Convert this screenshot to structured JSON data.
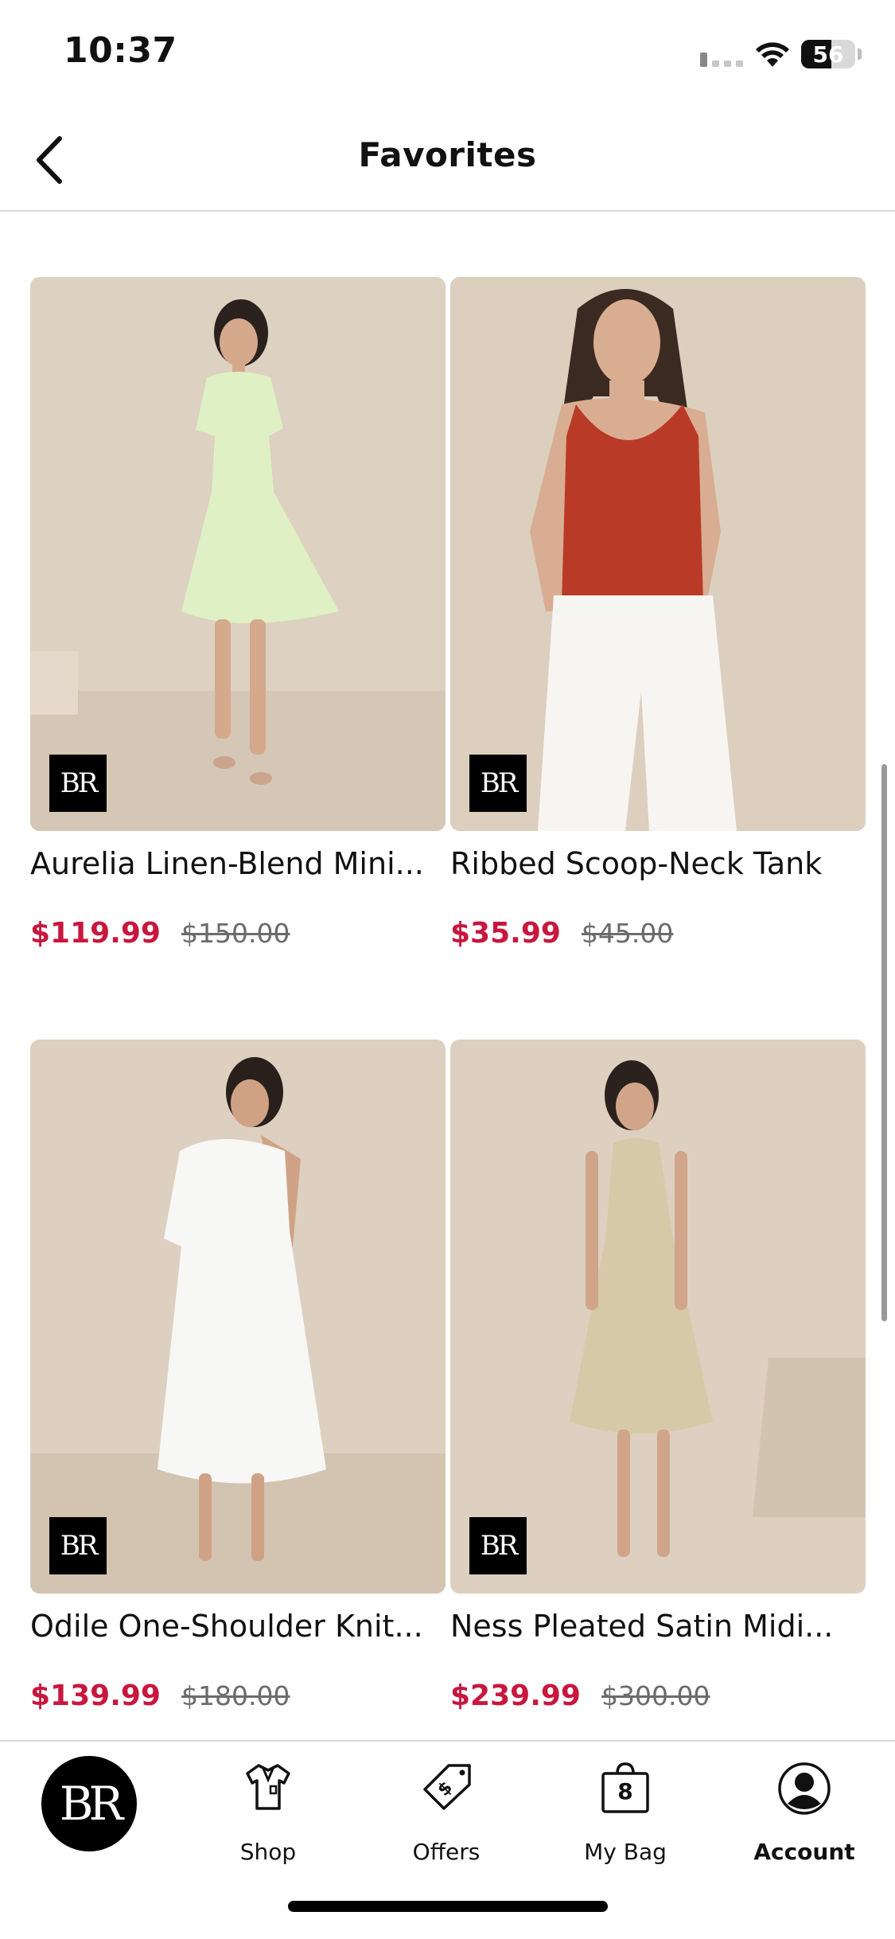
{
  "status_bar": {
    "time": "10:37",
    "battery_level": "56",
    "battery_fraction": 0.56
  },
  "header": {
    "title": "Favorites"
  },
  "products": [
    {
      "name": "Aurelia Linen-Blend Mini...",
      "sale_price": "$119.99",
      "original_price": "$150.00",
      "badge": "BR",
      "garment_color": "#dff0c4",
      "skin": "#d4a98c",
      "hair": "#2b211d"
    },
    {
      "name": "Ribbed Scoop-Neck Tank",
      "sale_price": "$35.99",
      "original_price": "$45.00",
      "badge": "BR",
      "garment_color": "#b93a26",
      "skin": "#d9ad92",
      "hair": "#3b2a22"
    },
    {
      "name": "Odile One-Shoulder Knit...",
      "sale_price": "$139.99",
      "original_price": "$180.00",
      "badge": "BR",
      "garment_color": "#f7f7f5",
      "skin": "#cfa286",
      "hair": "#2a201b"
    },
    {
      "name": "Ness Pleated Satin Midi...",
      "sale_price": "$239.99",
      "original_price": "$300.00",
      "badge": "BR",
      "garment_color": "#d6c9a8",
      "skin": "#d0a58a",
      "hair": "#2c221d"
    }
  ],
  "tab_bar": {
    "home_logo": "BR",
    "shop": "Shop",
    "offers": "Offers",
    "bag": "My Bag",
    "bag_count": "8",
    "account": "Account"
  },
  "colors": {
    "sale": "#c8173e",
    "photo_background": "#ddd1c1"
  }
}
